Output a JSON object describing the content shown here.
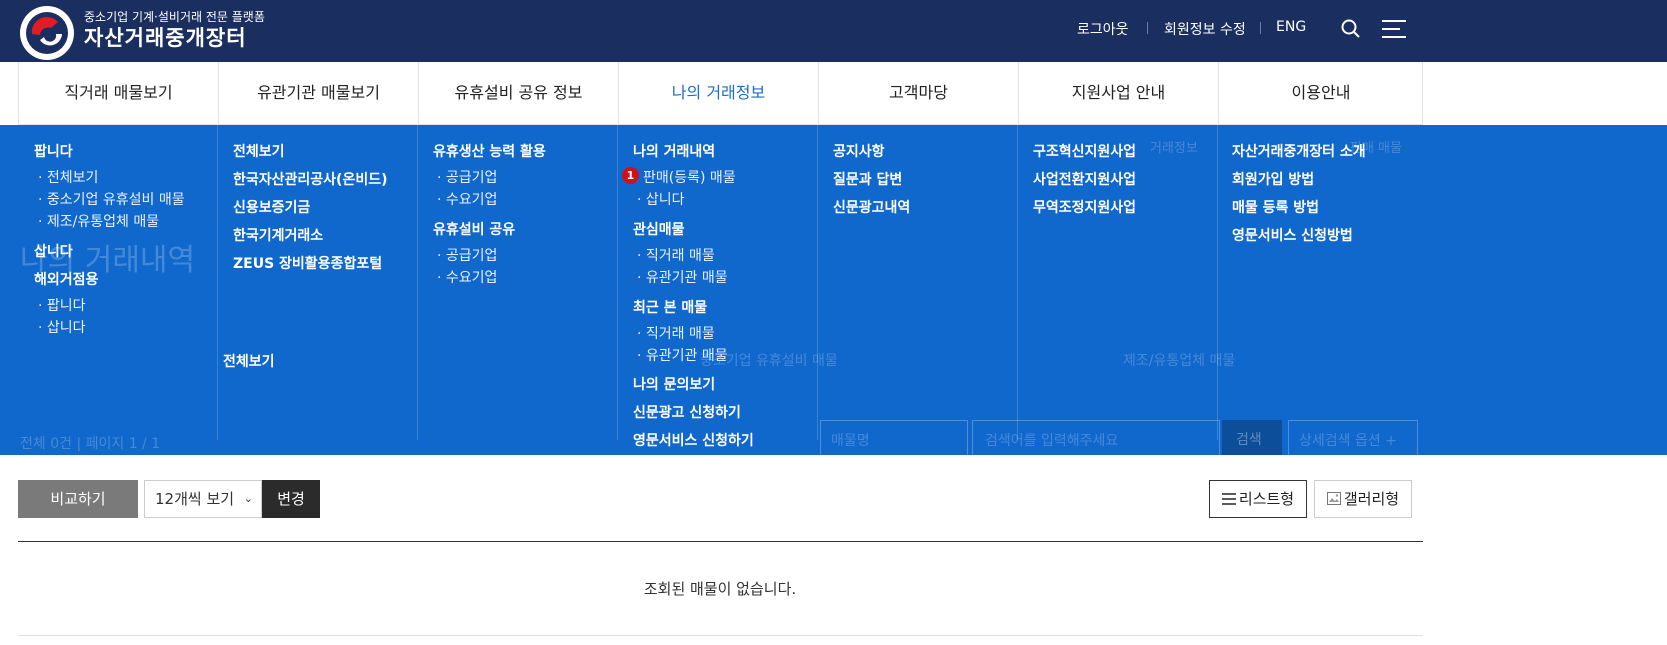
{
  "header": {
    "tagline": "중소기업 기계·설비거래 전문 플랫폼",
    "brand": "자산거래중개장터",
    "logout": "로그아웃",
    "edit_profile": "회원정보 수정",
    "language": "ENG"
  },
  "nav": {
    "items": [
      {
        "label": "직거래 매물보기"
      },
      {
        "label": "유관기관 매물보기"
      },
      {
        "label": "유휴설비 공유 정보"
      },
      {
        "label": "나의 거래정보"
      },
      {
        "label": "고객마당"
      },
      {
        "label": "지원사업 안내"
      },
      {
        "label": "이용안내"
      }
    ],
    "active_index": 3
  },
  "mega": {
    "col1": {
      "sell": "팝니다",
      "sell_all": "· 전체보기",
      "sell_sme": "· 중소기업 유휴설비 매물",
      "sell_mfg": "· 제조/유통업체 매물",
      "buy": "삽니다",
      "overseas": "해외거점용",
      "overseas_sell": "· 팝니다",
      "overseas_buy": "· 삽니다"
    },
    "col2": {
      "all": "전체보기",
      "kamco": "한국자산관리공사(온비드)",
      "kodit": "신용보증기금",
      "kmx": "한국기계거래소",
      "zeus": "ZEUS 장비활용종합포털"
    },
    "col3": {
      "capacity": "유휴생산 능력 활용",
      "supplier1": "· 공급기업",
      "demand1": "· 수요기업",
      "share": "유휴설비 공유",
      "supplier2": "· 공급기업",
      "demand2": "· 수요기업"
    },
    "col4": {
      "history": "나의 거래내역",
      "sale": "판매(등록) 매물",
      "sale_badge": "1",
      "buy": "· 삽니다",
      "interest": "관심매물",
      "interest_direct": "· 직거래 매물",
      "interest_agency": "· 유관기관 매물",
      "recent": "최근 본 매물",
      "recent_direct": "· 직거래 매물",
      "recent_agency": "· 유관기관 매물",
      "inquiry": "나의 문의보기",
      "ad_apply": "신문광고 신청하기",
      "english_apply": "영문서비스 신청하기"
    },
    "col5": {
      "notice": "공지사항",
      "qna": "질문과 답변",
      "ad_history": "신문광고내역"
    },
    "col6": {
      "restructure": "구조혁신지원사업",
      "conversion": "사업전환지원사업",
      "trade": "무역조정지원사업"
    },
    "col7": {
      "intro": "자산거래중개장터 소개",
      "join": "회원가입 방법",
      "register": "매물 등록 방법",
      "english": "영문서비스 신청방법"
    },
    "allview_label": "전체보기"
  },
  "underlay": {
    "page_title": "나의 거래내역",
    "count_text": "전체 0건 | 페이지 1 / 1",
    "tab_mid": "중소기업 유휴설비 매물",
    "tab_right": "제조/유통업체 매물",
    "search_select": "매물명",
    "search_placeholder": "검색어를 입력해주세요",
    "search_button": "검색",
    "detail_button": "상세검색 옵션 +",
    "corner_text1": "거래정보",
    "corner_text2": "판매 매물"
  },
  "toolbar": {
    "compare": "비교하기",
    "per_page": "12개씩 보기",
    "change": "변경",
    "list_view": "리스트형",
    "gallery_view": "갤러리형"
  },
  "empty_message": "조회된 매물이 없습니다.",
  "colors": {
    "header_bg": "#1a2f5f",
    "mega_bg": "#1068cc",
    "active_nav": "#1a6dd2",
    "badge": "#d40f1a"
  }
}
